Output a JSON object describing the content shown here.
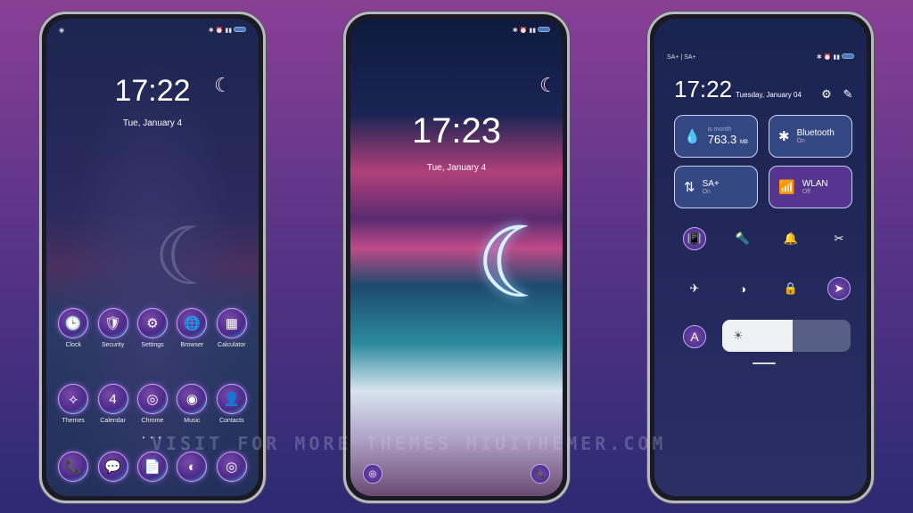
{
  "phone1": {
    "time": "17:22",
    "date": "Tue, January 4",
    "apps": [
      {
        "label": "Clock",
        "icon": "🕒"
      },
      {
        "label": "Security",
        "icon": "🛡"
      },
      {
        "label": "Settings",
        "icon": "⚙"
      },
      {
        "label": "Browser",
        "icon": "🌐"
      },
      {
        "label": "Calculator",
        "icon": "▦"
      },
      {
        "label": "Themes",
        "icon": "⟡"
      },
      {
        "label": "Calendar",
        "icon": "4"
      },
      {
        "label": "Chrome",
        "icon": "◎"
      },
      {
        "label": "Music",
        "icon": "◉"
      },
      {
        "label": "Contacts",
        "icon": "👤"
      }
    ],
    "dock": [
      {
        "icon": "📞"
      },
      {
        "icon": "💬"
      },
      {
        "icon": "📄"
      },
      {
        "icon": "◐"
      },
      {
        "icon": "◎"
      }
    ],
    "page_dots": "• • •"
  },
  "phone2": {
    "time": "17:23",
    "date": "Tue, January 4"
  },
  "phone3": {
    "carrier": "SA+ | SA+",
    "time": "17:22",
    "date": "Tuesday, January 04",
    "tiles": [
      {
        "title": "763.3",
        "unit": "MB",
        "sub": "is month",
        "icon": "💧"
      },
      {
        "title": "Bluetooth",
        "sub": "On",
        "icon": "✱"
      },
      {
        "title": "SA+",
        "sub": "On",
        "icon": "⇅"
      },
      {
        "title": "WLAN",
        "sub": "Off",
        "icon": "📶"
      }
    ],
    "brightness_level": 0.55
  },
  "watermark": "VISIT FOR MORE THEMES MIUITHEMER.COM",
  "colors": {
    "accent": "#8a5ad0",
    "background_top": "#8a3f95",
    "background_bottom": "#2c2a72"
  }
}
